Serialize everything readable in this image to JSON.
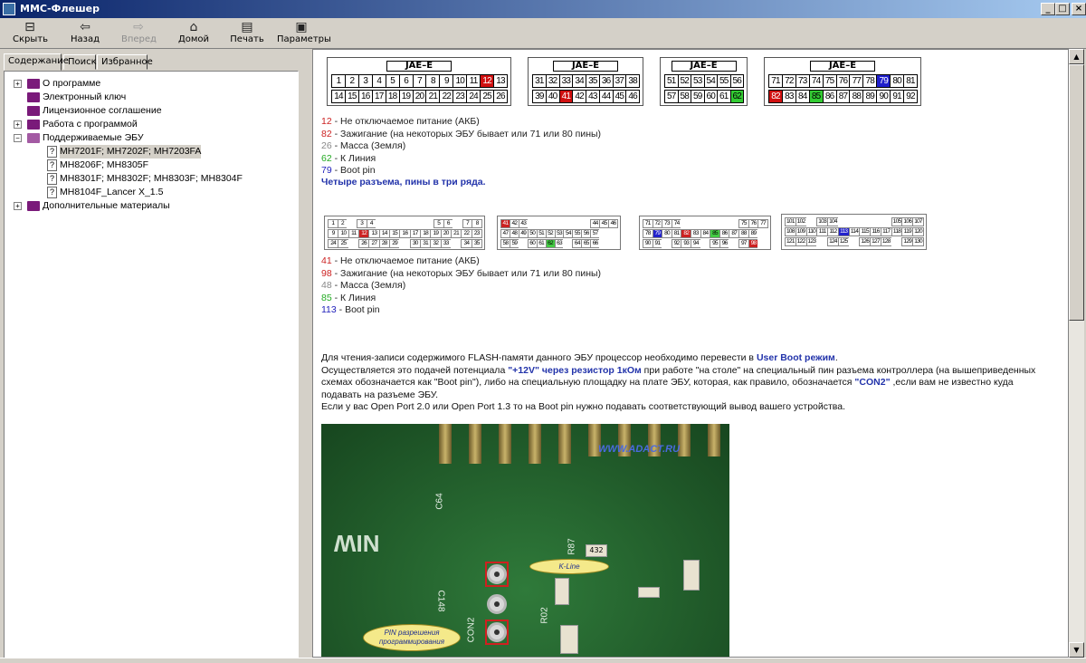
{
  "window": {
    "title": "ММС-Флешер"
  },
  "toolbar": {
    "hide": "Скрыть",
    "back": "Назад",
    "forward": "Вперед",
    "home": "Домой",
    "print": "Печать",
    "options": "Параметры"
  },
  "tabs": {
    "contents": "Содержание",
    "search": "Поиск",
    "favorites": "Избранное"
  },
  "tree": [
    {
      "label": "О программе",
      "expand": "+"
    },
    {
      "label": "Электронный ключ"
    },
    {
      "label": "Лицензионное соглашение"
    },
    {
      "label": "Работа с программой",
      "expand": "+"
    },
    {
      "label": "Поддерживаемые ЭБУ",
      "expand": "−"
    },
    {
      "label": "MH7201F; MH7202F; MH7203FA"
    },
    {
      "label": "MH8206F; MH8305F"
    },
    {
      "label": "MH8301F; MH8302F; MH8303F; MH8304F"
    },
    {
      "label": "MH8104F_Lancer X_1.5"
    },
    {
      "label": "Дополнительные материалы",
      "expand": "+"
    }
  ],
  "connector_label": "JAE–E",
  "connectors": [
    {
      "row1": [
        "1",
        "2",
        "3",
        "4",
        "5",
        "6",
        "7",
        "8",
        "9",
        "10",
        "11",
        "12",
        "13"
      ],
      "row2": [
        "14",
        "15",
        "16",
        "17",
        "18",
        "19",
        "20",
        "21",
        "22",
        "23",
        "24",
        "25",
        "26"
      ]
    },
    {
      "row1": [
        "31",
        "32",
        "33",
        "34",
        "35",
        "36",
        "37",
        "38"
      ],
      "row2": [
        "39",
        "40",
        "41",
        "42",
        "43",
        "44",
        "45",
        "46"
      ]
    },
    {
      "row1": [
        "51",
        "52",
        "53",
        "54",
        "55",
        "56"
      ],
      "row2": [
        "57",
        "58",
        "59",
        "60",
        "61",
        "62"
      ]
    },
    {
      "row1": [
        "71",
        "72",
        "73",
        "74",
        "75",
        "76",
        "77",
        "78",
        "79",
        "80",
        "81"
      ],
      "row2": [
        "82",
        "83",
        "84",
        "85",
        "86",
        "87",
        "88",
        "89",
        "90",
        "91",
        "92"
      ]
    }
  ],
  "legend1": [
    {
      "num": "12",
      "text": " - Не отключаемое питание (АКБ)",
      "color": "#cc2222"
    },
    {
      "num": "82",
      "text": " - Зажигание (на некоторых ЭБУ бывает или 71 или 80 пины)",
      "color": "#cc2222"
    },
    {
      "num": "26",
      "text": " - Масса (Земля)",
      "color": "#888888"
    },
    {
      "num": "62",
      "text": " - К Линия",
      "color": "#22aa22"
    },
    {
      "num": "79",
      "text": " - Boot pin",
      "color": "#2222bb"
    }
  ],
  "note1": "Четыре разъема, пины в три ряда.",
  "connectors2": [
    {
      "rows": [
        [
          "1",
          "2",
          "",
          "3",
          "4",
          "",
          "",
          "",
          "",
          "",
          "",
          "5",
          "6",
          "",
          "7",
          "8"
        ],
        [
          "9",
          "10",
          "11",
          "12",
          "13",
          "14",
          "15",
          "16",
          "17",
          "18",
          "19",
          "20",
          "21",
          "22",
          "23"
        ],
        [
          "24",
          "25",
          "",
          "26",
          "27",
          "28",
          "29",
          "",
          "30",
          "31",
          "32",
          "33",
          "",
          "34",
          "35"
        ]
      ]
    },
    {
      "rows": [
        [
          "41",
          "42",
          "43",
          "",
          "",
          "",
          "",
          "",
          "",
          "",
          "44",
          "45",
          "46"
        ],
        [
          "47",
          "48",
          "49",
          "50",
          "51",
          "52",
          "53",
          "54",
          "55",
          "56",
          "57",
          "",
          ""
        ],
        [
          "58",
          "59",
          "",
          "60",
          "61",
          "62",
          "63",
          "",
          "64",
          "65",
          "66",
          "",
          ""
        ]
      ]
    },
    {
      "rows": [
        [
          "71",
          "72",
          "73",
          "74",
          "",
          "",
          "",
          "",
          "",
          "",
          "75",
          "76",
          "77"
        ],
        [
          "78",
          "79",
          "80",
          "81",
          "82",
          "83",
          "84",
          "85",
          "86",
          "87",
          "88",
          "89",
          ""
        ],
        [
          "90",
          "91",
          "",
          "92",
          "93",
          "94",
          "",
          "95",
          "96",
          "",
          "97",
          "98",
          ""
        ]
      ]
    },
    {
      "rows": [
        [
          "101",
          "102",
          "",
          "103",
          "104",
          "",
          "",
          "",
          "",
          "",
          "105",
          "106",
          "107"
        ],
        [
          "108",
          "109",
          "110",
          "111",
          "112",
          "113",
          "114",
          "115",
          "116",
          "117",
          "118",
          "119",
          "120"
        ],
        [
          "121",
          "122",
          "123",
          "",
          "124",
          "125",
          "",
          "126",
          "127",
          "128",
          "",
          "129",
          "130"
        ]
      ]
    }
  ],
  "legend2": [
    {
      "num": "41",
      "text": " - Не отключаемое питание (АКБ)",
      "color": "#cc2222"
    },
    {
      "num": "98",
      "text": " - Зажигание (на некоторых ЭБУ бывает или 71 или 80 пины)",
      "color": "#cc2222"
    },
    {
      "num": "48",
      "text": " - Масса (Земля)",
      "color": "#888888"
    },
    {
      "num": "85",
      "text": " - К Линия",
      "color": "#22aa22"
    },
    {
      "num": "113",
      "text": " - Boot pin",
      "color": "#2222bb"
    }
  ],
  "para": {
    "l1a": "Для чтения-записи содержимого FLASH-памяти данного ЭБУ процессор необходимо перевести в ",
    "l1b": "User Boot режим",
    "l1c": ".",
    "l2a": "Осуществляется это подачей потенциала ",
    "l2b": "\"+12V\" через резистор 1кОм",
    "l2c": " при  работе \"на столе\" на специальный пин разъема контроллера (на вышеприведенных",
    "l3a": "схемах обозначается как \"Boot pin\"), либо на специальную площадку на плате ЭБУ, которая, как правило, обозначается ",
    "l3b": "\"CON2\"",
    "l3c": " ,если вам не известно куда",
    "l4": "подавать на разъеме ЭБУ.",
    "l5": "Если у вас Open Port 2.0 или Open Port 1.3 то на Boot pin нужно подавать соответствующий вывод вашего устройства."
  },
  "photo": {
    "watermark": "WWW.ADACT.RU",
    "kline": "K-Line",
    "pin_line1": "PIN разрешения",
    "pin_line2": "программирования",
    "silk_nim": "NIW",
    "silk_c64": "C64",
    "silk_c148": "C148",
    "silk_r02": "R02",
    "silk_con2": "CON2",
    "silk_r87": "R87",
    "silk_432": "432"
  }
}
